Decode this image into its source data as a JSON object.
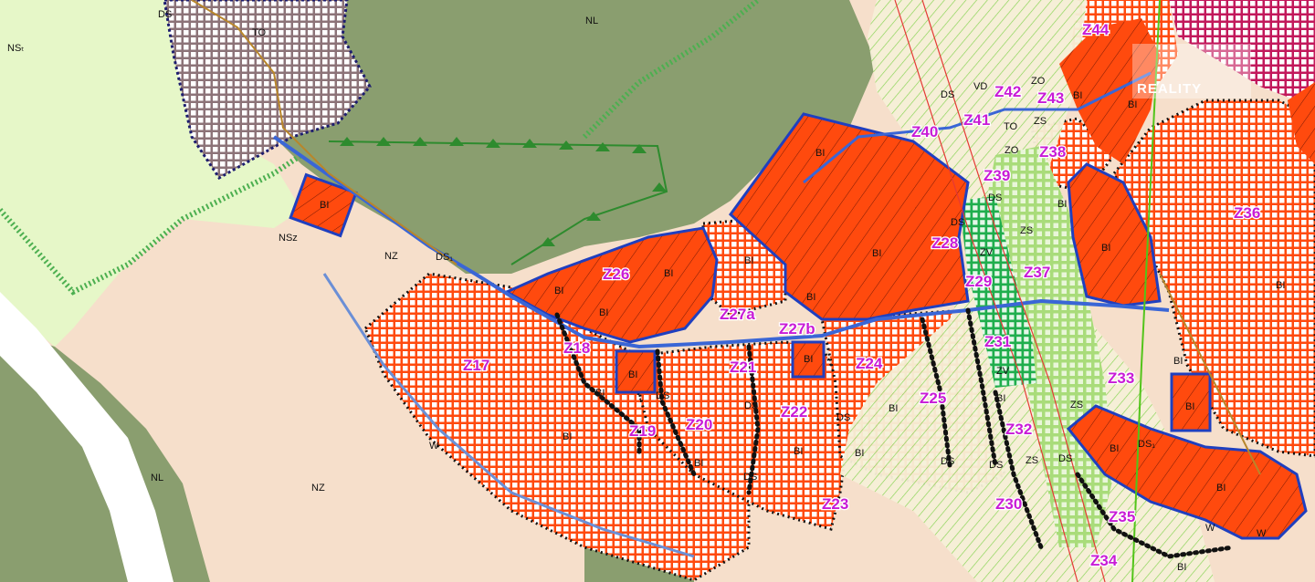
{
  "labels": {
    "nl_top": "NL",
    "nl_bottom": "NL",
    "ns_top": "NSₜ",
    "ns_mid": "NSz",
    "nz_top": "NZ",
    "nz_bottom": "NZ",
    "ds_topleft": "DS",
    "to_top": "TO",
    "ds1_road": "DS₁",
    "w_path": "W",
    "w_right": "W",
    "w_right2": "W",
    "vd": "VD",
    "zo1": "ZO",
    "zo2": "ZO",
    "to2": "TO",
    "zs1": "ZS",
    "zs2": "ZS",
    "zs3": "ZS",
    "zs4": "ZS",
    "zv1": "ZV",
    "zv2": "ZV",
    "ds_a": "DS",
    "ds_b": "DS",
    "ds_c": "DS",
    "ds_d": "DS",
    "ds_e": "DS",
    "ds_f": "DS",
    "ds_g": "DS",
    "ds_h": "DS",
    "ds_i": "DS",
    "ds_j": "DS",
    "ds1_right": "DS₁"
  },
  "bi_label": "BI",
  "zones": [
    {
      "id": "z17",
      "text": "Z17"
    },
    {
      "id": "z18",
      "text": "Z18"
    },
    {
      "id": "z19",
      "text": "Z19"
    },
    {
      "id": "z20",
      "text": "Z20"
    },
    {
      "id": "z21",
      "text": "Z21"
    },
    {
      "id": "z22",
      "text": "Z22"
    },
    {
      "id": "z23",
      "text": "Z23"
    },
    {
      "id": "z24",
      "text": "Z24"
    },
    {
      "id": "z25",
      "text": "Z25"
    },
    {
      "id": "z26",
      "text": "Z26"
    },
    {
      "id": "z27a",
      "text": "Z27a"
    },
    {
      "id": "z27b",
      "text": "Z27b"
    },
    {
      "id": "z28",
      "text": "Z28"
    },
    {
      "id": "z29",
      "text": "Z29"
    },
    {
      "id": "z30",
      "text": "Z30"
    },
    {
      "id": "z31",
      "text": "Z31"
    },
    {
      "id": "z32",
      "text": "Z32"
    },
    {
      "id": "z33",
      "text": "Z33"
    },
    {
      "id": "z34",
      "text": "Z34"
    },
    {
      "id": "z35",
      "text": "Z35"
    },
    {
      "id": "z36",
      "text": "Z36"
    },
    {
      "id": "z37",
      "text": "Z37"
    },
    {
      "id": "z38",
      "text": "Z38"
    },
    {
      "id": "z39",
      "text": "Z39"
    },
    {
      "id": "z40",
      "text": "Z40"
    },
    {
      "id": "z41",
      "text": "Z41"
    },
    {
      "id": "z42",
      "text": "Z42"
    },
    {
      "id": "z43",
      "text": "Z43"
    },
    {
      "id": "z44",
      "text": "Z44"
    }
  ],
  "watermark": {
    "text": "REALITY"
  },
  "colors": {
    "forest": "#8a9e6f",
    "meadow": "#e6f7c8",
    "arable": "#f6dfcb",
    "housing": "#ff4a0e",
    "housing_plan": "#ff5a1a",
    "village": "#a28a8e",
    "green_zone": "#22c05a",
    "road_blue": "#3a66d6",
    "label_magenta": "#c81bd6"
  }
}
